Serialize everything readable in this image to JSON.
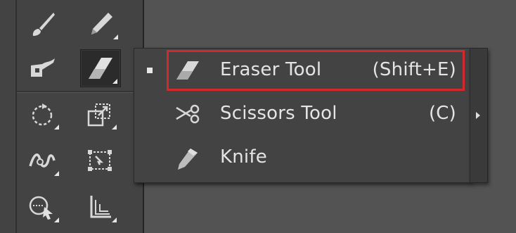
{
  "toolbar": {
    "tools": [
      {
        "name": "paintbrush-tool",
        "icon": "paintbrush-icon"
      },
      {
        "name": "pencil-tool",
        "icon": "pencil-icon"
      },
      {
        "name": "blob-brush-tool",
        "icon": "blob-brush-icon"
      },
      {
        "name": "eraser-tool",
        "icon": "eraser-icon",
        "active": true
      },
      {
        "name": "rotate-tool",
        "icon": "rotate-icon"
      },
      {
        "name": "scale-tool",
        "icon": "scale-icon"
      },
      {
        "name": "width-tool",
        "icon": "width-icon"
      },
      {
        "name": "free-transform-tool",
        "icon": "free-transform-icon"
      },
      {
        "name": "shape-builder-tool",
        "icon": "shape-builder-icon"
      },
      {
        "name": "perspective-grid-tool",
        "icon": "perspective-grid-icon"
      }
    ]
  },
  "flyout": {
    "items": [
      {
        "label": "Eraser Tool",
        "shortcut": "(Shift+E)",
        "icon": "eraser-icon",
        "selected": true,
        "highlighted": true
      },
      {
        "label": "Scissors Tool",
        "shortcut": "(C)",
        "icon": "scissors-icon",
        "selected": false
      },
      {
        "label": "Knife",
        "shortcut": "",
        "icon": "knife-icon",
        "selected": false
      }
    ]
  },
  "colors": {
    "panel_bg": "#434343",
    "canvas_bg": "#535353",
    "highlight": "#d3282e",
    "text": "#e4e4e4"
  }
}
